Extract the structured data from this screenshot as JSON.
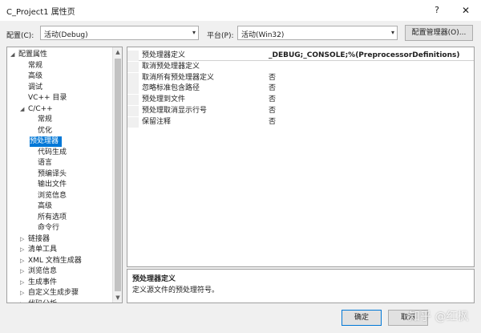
{
  "window": {
    "title": "C_Project1 属性页",
    "help": "?",
    "close": "✕"
  },
  "toolbar": {
    "config_label": "配置(C):",
    "config_value": "活动(Debug)",
    "platform_label": "平台(P):",
    "platform_value": "活动(Win32)",
    "config_manager": "配置管理器(O)..."
  },
  "tree": [
    {
      "label": "配置属性",
      "expander": "◢",
      "selected": false
    },
    {
      "label": "常规",
      "expander": "",
      "selected": false
    },
    {
      "label": "高级",
      "expander": "",
      "selected": false
    },
    {
      "label": "调试",
      "expander": "",
      "selected": false
    },
    {
      "label": "VC++ 目录",
      "expander": "",
      "selected": false
    },
    {
      "label": "C/C++",
      "expander": "◢",
      "selected": false
    },
    {
      "label": "常规",
      "expander": "",
      "selected": false
    },
    {
      "label": "优化",
      "expander": "",
      "selected": false
    },
    {
      "label": "预处理器",
      "expander": "",
      "selected": true
    },
    {
      "label": "代码生成",
      "expander": "",
      "selected": false
    },
    {
      "label": "语言",
      "expander": "",
      "selected": false
    },
    {
      "label": "预编译头",
      "expander": "",
      "selected": false
    },
    {
      "label": "输出文件",
      "expander": "",
      "selected": false
    },
    {
      "label": "浏览信息",
      "expander": "",
      "selected": false
    },
    {
      "label": "高级",
      "expander": "",
      "selected": false
    },
    {
      "label": "所有选项",
      "expander": "",
      "selected": false
    },
    {
      "label": "命令行",
      "expander": "",
      "selected": false
    },
    {
      "label": "链接器",
      "expander": "▷",
      "selected": false
    },
    {
      "label": "清单工具",
      "expander": "▷",
      "selected": false
    },
    {
      "label": "XML 文档生成器",
      "expander": "▷",
      "selected": false
    },
    {
      "label": "浏览信息",
      "expander": "▷",
      "selected": false
    },
    {
      "label": "生成事件",
      "expander": "▷",
      "selected": false
    },
    {
      "label": "自定义生成步骤",
      "expander": "▷",
      "selected": false
    },
    {
      "label": "代码分析",
      "expander": "▷",
      "selected": false
    }
  ],
  "properties": [
    {
      "name": "预处理器定义",
      "value": "_DEBUG;_CONSOLE;%(PreprocessorDefinitions)",
      "bold": true
    },
    {
      "name": "取消预处理器定义",
      "value": "",
      "bold": false
    },
    {
      "name": "取消所有预处理器定义",
      "value": "否",
      "bold": false
    },
    {
      "name": "忽略标准包含路径",
      "value": "否",
      "bold": false
    },
    {
      "name": "预处理到文件",
      "value": "否",
      "bold": false
    },
    {
      "name": "预处理取消显示行号",
      "value": "否",
      "bold": false
    },
    {
      "name": "保留注释",
      "value": "否",
      "bold": false
    }
  ],
  "description": {
    "title": "预处理器定义",
    "text": "定义源文件的预处理符号。"
  },
  "footer": {
    "ok": "确定",
    "cancel": "取消",
    "watermark": "知乎 @红枫"
  },
  "icons": {
    "dropdown": "▾"
  }
}
